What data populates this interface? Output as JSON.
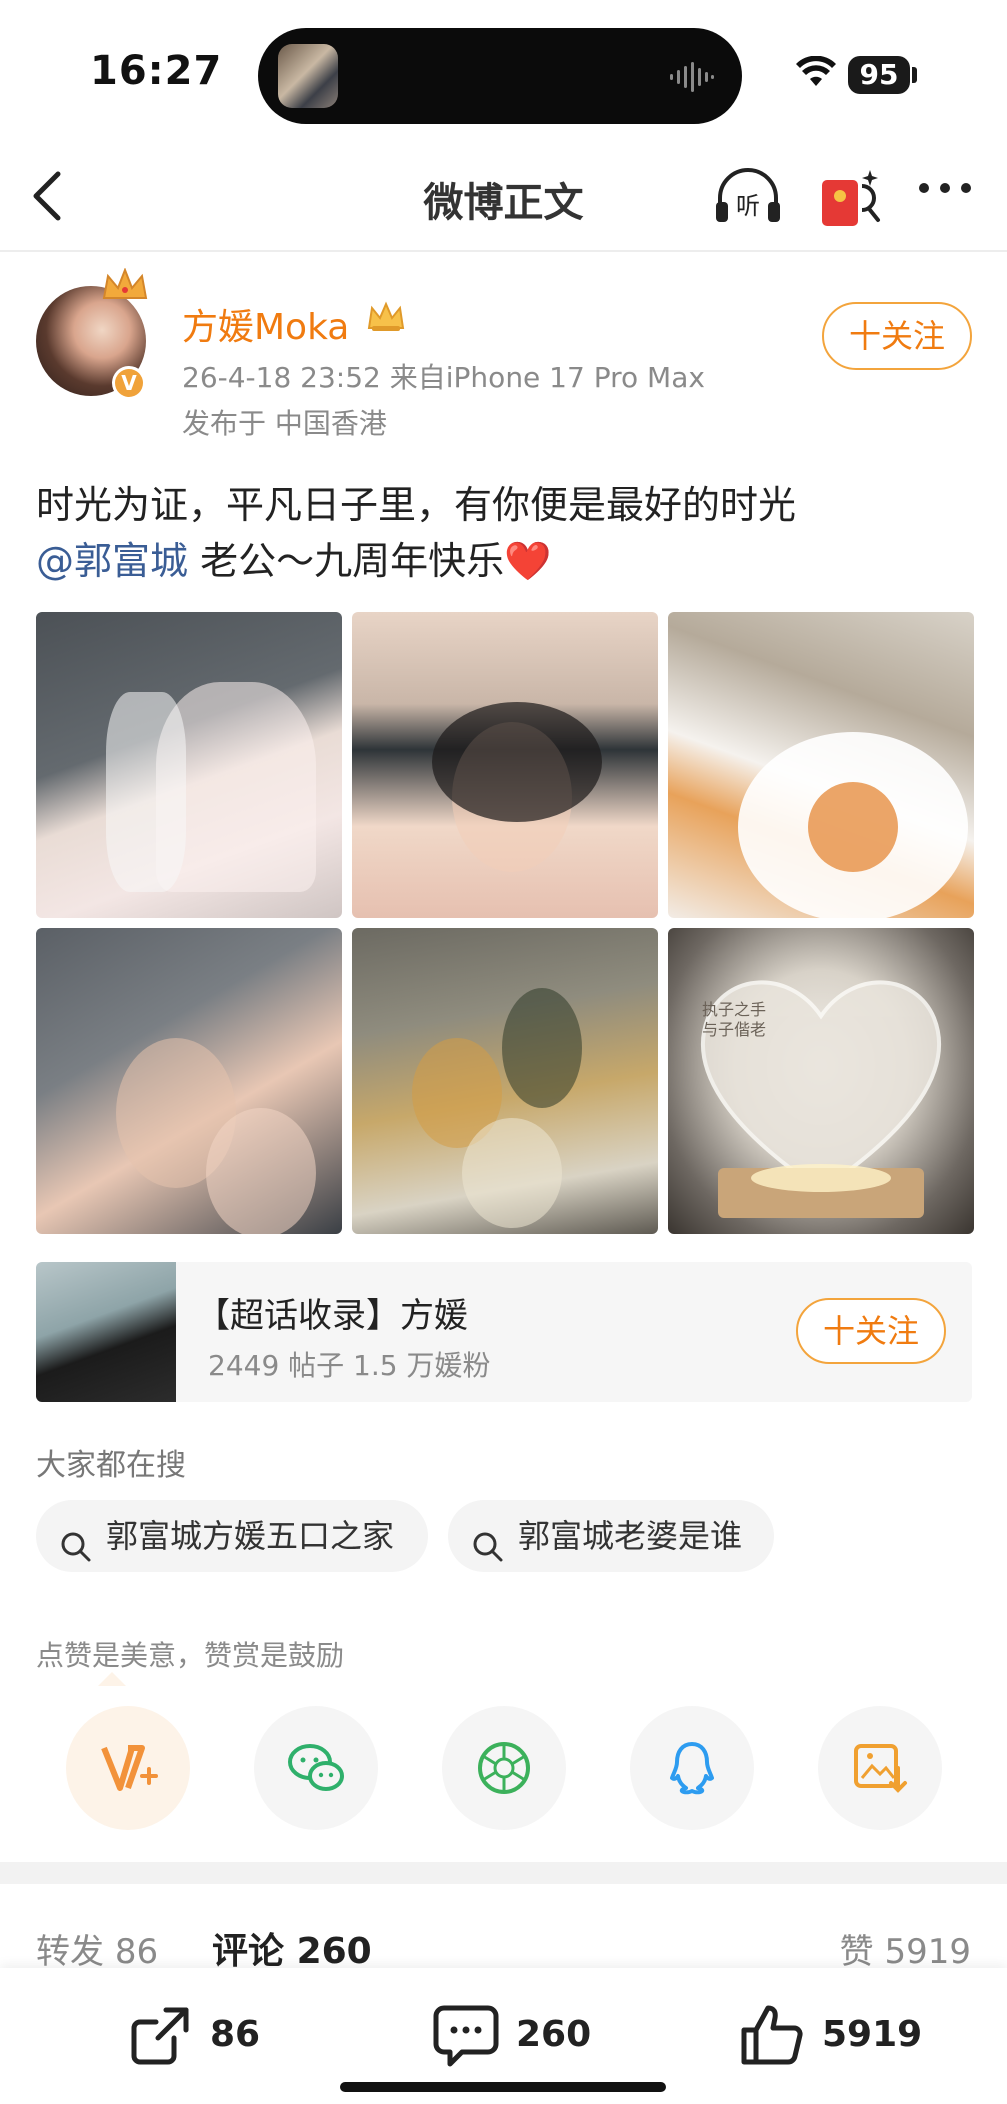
{
  "status_bar": {
    "time": "16:27",
    "battery": "95"
  },
  "nav": {
    "title": "微博正文"
  },
  "author": {
    "name": "方媛Moka",
    "meta": "26-4-18 23:52  来自iPhone 17 Pro Max",
    "location": "发布于 中国香港",
    "follow_label": "十关注"
  },
  "post": {
    "line1": "时光为证，平凡日子里，有你便是最好的时光",
    "mention": "@郭富城",
    "line2_rest": " 老公～九周年快乐",
    "heart": "❤️",
    "photo_captions": [
      "执子之手",
      "与子偕老"
    ]
  },
  "super_topic": {
    "title": "【超话收录】方媛",
    "stats": "2449 帖子  1.5 万媛粉",
    "follow_label": "十关注"
  },
  "searches": {
    "header": "大家都在搜",
    "items": [
      "郭富城方媛五口之家",
      "郭富城老婆是谁"
    ]
  },
  "reward": {
    "hint": "点赞是美意，赞赏是鼓励"
  },
  "tabs": {
    "repost_label": "转发",
    "repost_count": "86",
    "comment_label": "评论",
    "comment_count": "260",
    "like_label": "赞",
    "like_count": "5919"
  },
  "bottom_actions": {
    "repost": "86",
    "comment": "260",
    "like": "5919"
  },
  "colors": {
    "accent": "#f07b10",
    "mention": "#3a5d95",
    "follow_border": "#f3a43c"
  }
}
